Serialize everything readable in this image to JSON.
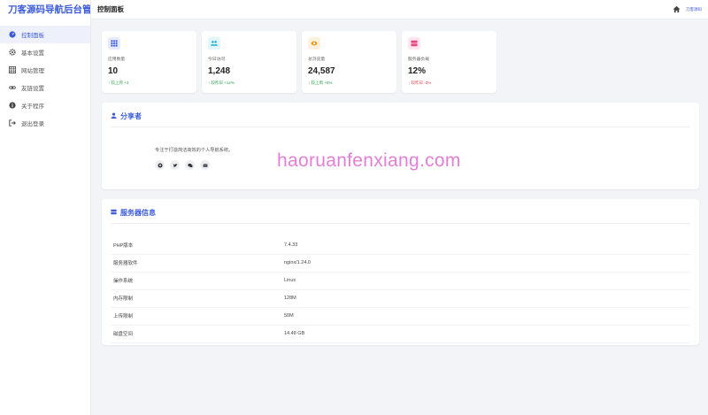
{
  "app": {
    "title": "刀客源码导航后台管理"
  },
  "sidebar": {
    "items": [
      {
        "label": "控制面板",
        "icon": "dashboard-icon",
        "active": true
      },
      {
        "label": "基本设置",
        "icon": "gear-icon"
      },
      {
        "label": "网站管理",
        "icon": "grid-icon"
      },
      {
        "label": "友链设置",
        "icon": "link-icon"
      },
      {
        "label": "关于程序",
        "icon": "info-icon"
      },
      {
        "label": "退出登录",
        "icon": "logout-icon"
      }
    ]
  },
  "header": {
    "title": "控制面板",
    "user": "刀客源码",
    "home_icon": "home-icon"
  },
  "stats": [
    {
      "label": "应用数量",
      "value": "10",
      "trend": "较上月 +3",
      "direction": "up",
      "icon": "grid-icon",
      "color": "#3b5bdb",
      "bg": "#e7ebfb"
    },
    {
      "label": "今日访问",
      "value": "1,248",
      "trend": "较昨日 +12%",
      "direction": "up",
      "icon": "users-icon",
      "color": "#23b0d6",
      "bg": "#e3f6fb"
    },
    {
      "label": "总浏览量",
      "value": "24,587",
      "trend": "较上周 +5%",
      "direction": "up",
      "icon": "eye-icon",
      "color": "#f08c00",
      "bg": "#fff1dd"
    },
    {
      "label": "服务器负载",
      "value": "12%",
      "trend": "较昨日 -3%",
      "direction": "down",
      "icon": "server-icon",
      "color": "#e64980",
      "bg": "#fde6ef"
    }
  ],
  "share": {
    "title": "分享者",
    "description": "专注于打造简洁高效的个人导航系统。",
    "socials": [
      "github-icon",
      "twitter-icon",
      "wechat-icon",
      "email-icon"
    ]
  },
  "server": {
    "title": "服务器信息",
    "rows": [
      {
        "key": "PHP版本",
        "value": "7.4.33"
      },
      {
        "key": "服务器软件",
        "value": "nginx/1.24.0"
      },
      {
        "key": "操作系统",
        "value": "Linux"
      },
      {
        "key": "内存限制",
        "value": "128M"
      },
      {
        "key": "上传限制",
        "value": "50M"
      },
      {
        "key": "磁盘空间",
        "value": "14.48 GB"
      }
    ]
  },
  "watermark": "haoruanfenxiang.com"
}
